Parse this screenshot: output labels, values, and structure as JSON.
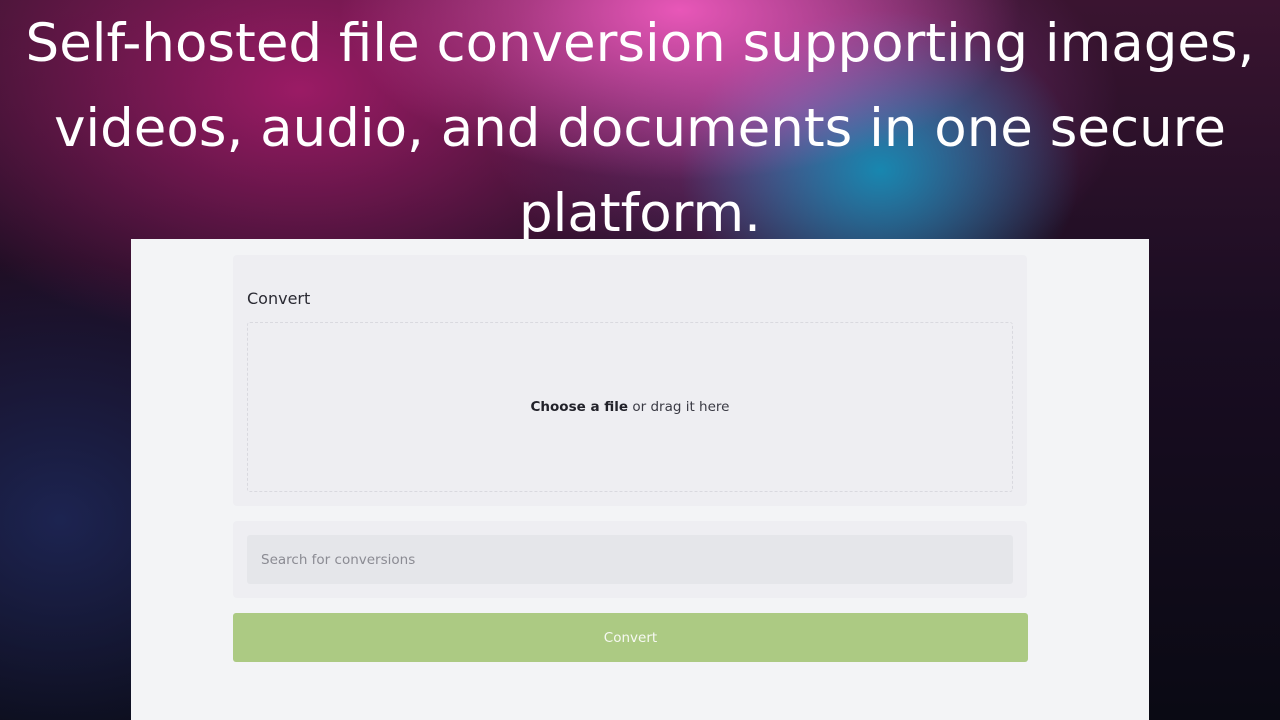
{
  "hero": {
    "title": "Self-hosted file conversion supporting images, videos, audio, and documents in one secure platform."
  },
  "convert_card": {
    "title": "Convert",
    "dropzone": {
      "choose_label": "Choose a file",
      "drag_label": " or drag it here"
    }
  },
  "search": {
    "placeholder": "Search for conversions",
    "value": ""
  },
  "convert_button": {
    "label": "Convert",
    "color": "#acca83"
  },
  "colors": {
    "app_background": "#f3f4f6",
    "card_background": "#eeeef2",
    "input_background": "#e5e6ea"
  }
}
